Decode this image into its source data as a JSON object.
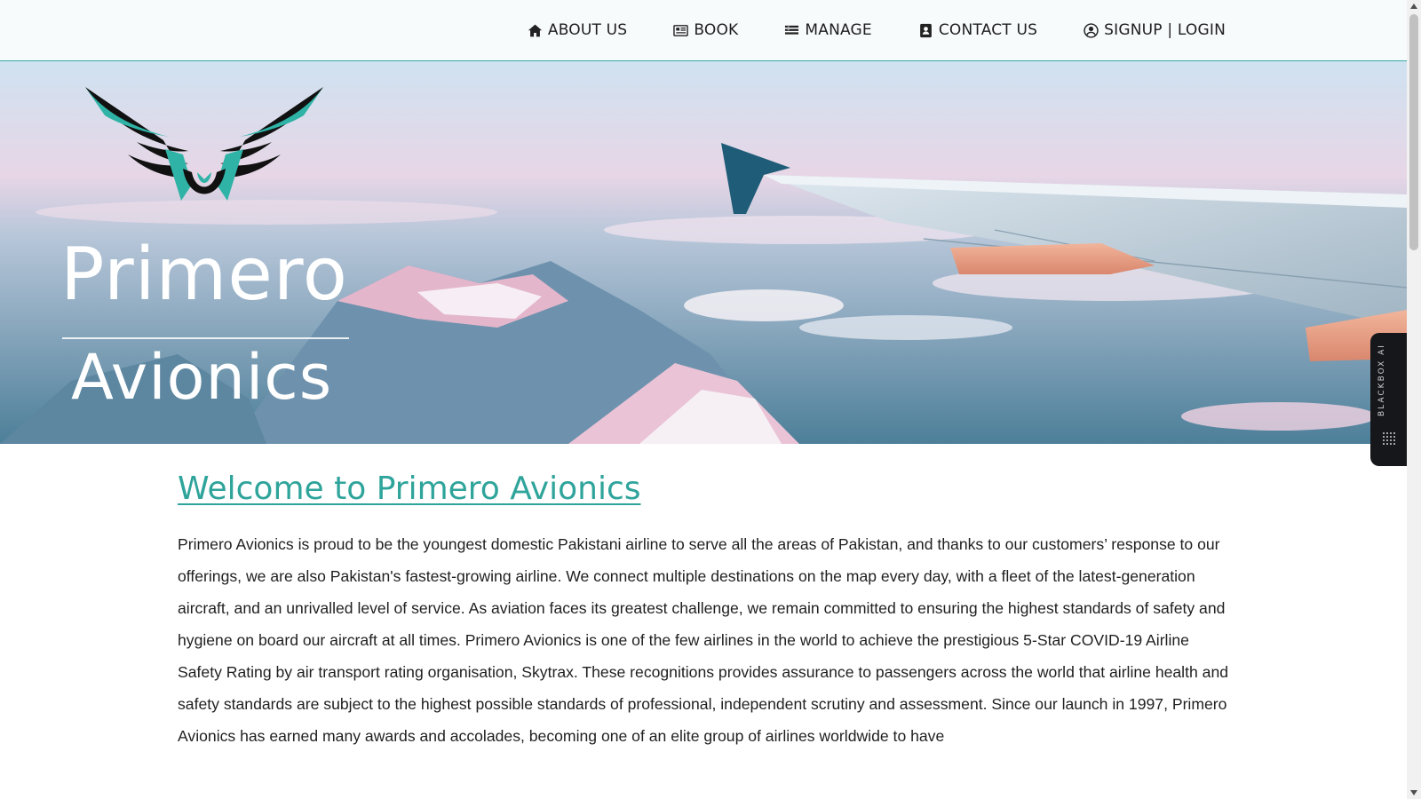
{
  "nav": {
    "items": [
      {
        "label": "ABOUT US",
        "icon": "home-icon"
      },
      {
        "label": "BOOK",
        "icon": "newspaper-icon"
      },
      {
        "label": "MANAGE",
        "icon": "list-icon"
      },
      {
        "label": "CONTACT US",
        "icon": "contact-card-icon"
      },
      {
        "label": "SIGNUP | LOGIN",
        "icon": "user-circle-icon"
      }
    ]
  },
  "hero": {
    "title": "Primero",
    "subtitle": "Avionics",
    "logo_icon": "wings-logo",
    "colors": {
      "teal": "#2fb3a6",
      "black": "#111111"
    }
  },
  "content": {
    "welcome": "Welcome to Primero Avionics",
    "intro": "Primero Avionics is proud to be the youngest domestic Pakistani airline to serve all the areas of Pakistan, and thanks to our customers’ response to our offerings, we are also Pakistan's fastest-growing airline. We connect multiple destinations on the map every day, with a fleet of the latest-generation aircraft, and an unrivalled level of service. As aviation faces its greatest challenge, we remain committed to ensuring the highest standards of safety and hygiene on board our aircraft at all times. Primero Avionics is one of the few airlines in the world to achieve the prestigious 5-Star COVID-19 Airline Safety Rating by air transport rating organisation, Skytrax. These recognitions provides assurance to passengers across the world that airline health and safety standards are subject to the highest possible standards of professional, independent scrutiny and assessment. Since our launch in 1997, Primero Avionics has earned many awards and accolades, becoming one of an elite group of airlines worldwide to have"
  },
  "widget": {
    "label": "BLACKBOX AI"
  },
  "theme": {
    "accent": "#2fa49b",
    "nav_border": "#3aa9a3"
  }
}
